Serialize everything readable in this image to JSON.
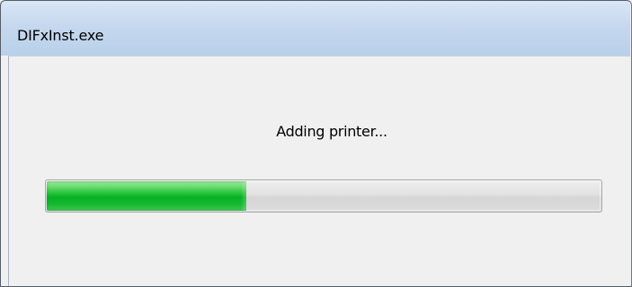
{
  "window": {
    "title": "DIFxInst.exe"
  },
  "dialog": {
    "status_text": "Adding printer...",
    "progress": 0.36
  },
  "colors": {
    "title_bar": "#c6d8ee",
    "progress_fill": "#06b025",
    "progress_track": "#e2e2e2",
    "client_background": "#f0f0f0"
  }
}
